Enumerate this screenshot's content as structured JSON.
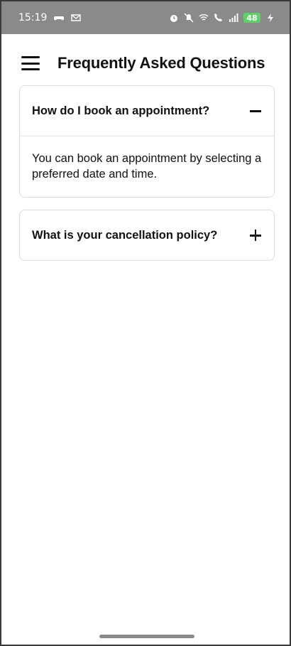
{
  "status_bar": {
    "time": "15:19",
    "battery": "48",
    "left_icons": [
      "game-controller-icon",
      "mail-icon"
    ],
    "right_icons": [
      "alarm-icon",
      "mute-icon",
      "wifi-call-icon",
      "call-icon",
      "signal-icon",
      "battery-icon",
      "charging-icon"
    ]
  },
  "header": {
    "menu_icon": "hamburger-menu-icon",
    "title": "Frequently Asked Questions"
  },
  "faq": [
    {
      "question": "How do I book an appointment?",
      "answer": "You can book an appointment by selecting a preferred date and time.",
      "expanded": true,
      "toggle_icon": "minus-icon"
    },
    {
      "question": "What is your cancellation policy?",
      "expanded": false,
      "toggle_icon": "plus-icon"
    }
  ],
  "colors": {
    "status_bar_bg": "#8a8a8a",
    "battery": "#5fd16a",
    "card_border": "#dcdcdc",
    "text": "#111111"
  }
}
